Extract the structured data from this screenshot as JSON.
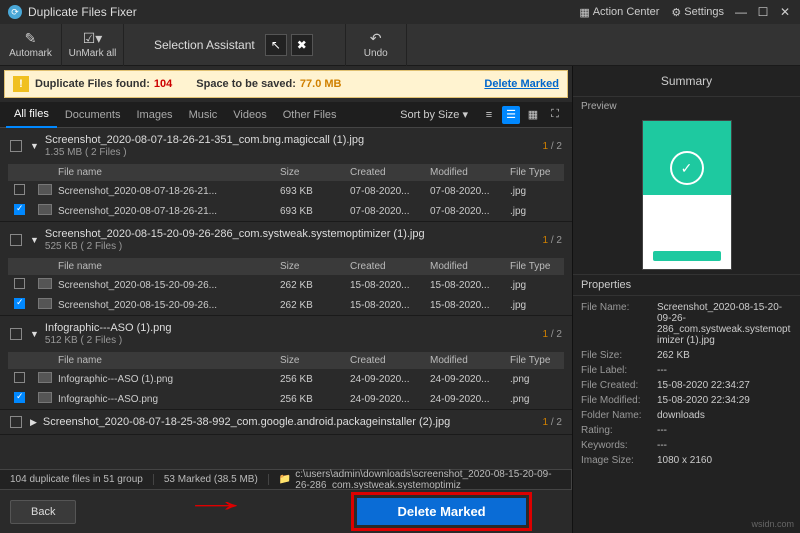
{
  "titlebar": {
    "app_name": "Duplicate Files Fixer",
    "action_center": "Action Center",
    "settings": "Settings"
  },
  "toolbar": {
    "automark": "Automark",
    "unmark_all": "UnMark all",
    "selection_assistant": "Selection Assistant",
    "undo": "Undo"
  },
  "banner": {
    "found_label": "Duplicate Files found:",
    "found_count": "104",
    "space_label": "Space to be saved:",
    "space_value": "77.0 MB",
    "delete_marked": "Delete Marked"
  },
  "tabs": {
    "items": [
      "All files",
      "Documents",
      "Images",
      "Music",
      "Videos",
      "Other Files"
    ],
    "sort": "Sort by Size ▾"
  },
  "columns": {
    "name": "File name",
    "size": "Size",
    "created": "Created",
    "modified": "Modified",
    "type": "File Type"
  },
  "groups": [
    {
      "checked": false,
      "name": "Screenshot_2020-08-07-18-26-21-351_com.bng.magiccall (1).jpg",
      "meta": "1.35 MB  ( 2 Files )",
      "count_hl": "1",
      "count_total": "/ 2",
      "rows": [
        {
          "checked": false,
          "name": "Screenshot_2020-08-07-18-26-21...",
          "size": "693 KB",
          "created": "07-08-2020...",
          "modified": "07-08-2020...",
          "type": ".jpg"
        },
        {
          "checked": true,
          "name": "Screenshot_2020-08-07-18-26-21...",
          "size": "693 KB",
          "created": "07-08-2020...",
          "modified": "07-08-2020...",
          "type": ".jpg"
        }
      ]
    },
    {
      "checked": false,
      "name": "Screenshot_2020-08-15-20-09-26-286_com.systweak.systemoptimizer (1).jpg",
      "meta": "525 KB  ( 2 Files )",
      "count_hl": "1",
      "count_total": "/ 2",
      "rows": [
        {
          "checked": false,
          "name": "Screenshot_2020-08-15-20-09-26...",
          "size": "262 KB",
          "created": "15-08-2020...",
          "modified": "15-08-2020...",
          "type": ".jpg"
        },
        {
          "checked": true,
          "name": "Screenshot_2020-08-15-20-09-26...",
          "size": "262 KB",
          "created": "15-08-2020...",
          "modified": "15-08-2020...",
          "type": ".jpg"
        }
      ]
    },
    {
      "checked": false,
      "name": "Infographic---ASO (1).png",
      "meta": "512 KB  ( 2 Files )",
      "count_hl": "1",
      "count_total": "/ 2",
      "rows": [
        {
          "checked": false,
          "name": "Infographic---ASO (1).png",
          "size": "256 KB",
          "created": "24-09-2020...",
          "modified": "24-09-2020...",
          "type": ".png"
        },
        {
          "checked": true,
          "name": "Infographic---ASO.png",
          "size": "256 KB",
          "created": "24-09-2020...",
          "modified": "24-09-2020...",
          "type": ".png"
        }
      ]
    },
    {
      "checked": false,
      "name": "Screenshot_2020-08-07-18-25-38-992_com.google.android.packageinstaller (2).jpg",
      "count_hl": "1",
      "count_total": "/ 2",
      "collapsed": true
    }
  ],
  "status": {
    "dup": "104 duplicate files in 51 group",
    "marked": "53 Marked (38.5 MB)",
    "path": "c:\\users\\admin\\downloads\\screenshot_2020-08-15-20-09-26-286_com.systweak.systemoptimiz"
  },
  "footer": {
    "back": "Back",
    "delete": "Delete Marked"
  },
  "right": {
    "summary": "Summary",
    "preview": "Preview",
    "properties": "Properties",
    "props": [
      {
        "k": "File Name:",
        "v": "Screenshot_2020-08-15-20-09-26-286_com.systweak.systemoptimizer (1).jpg"
      },
      {
        "k": "File Size:",
        "v": "262 KB"
      },
      {
        "k": "File Label:",
        "v": "---"
      },
      {
        "k": "File Created:",
        "v": "15-08-2020 22:34:27"
      },
      {
        "k": "File Modified:",
        "v": "15-08-2020 22:34:29"
      },
      {
        "k": "Folder Name:",
        "v": "downloads"
      },
      {
        "k": "Rating:",
        "v": "---"
      },
      {
        "k": "Keywords:",
        "v": "---"
      },
      {
        "k": "Image Size:",
        "v": "1080 x 2160"
      }
    ]
  },
  "watermark": "wsidn.com"
}
